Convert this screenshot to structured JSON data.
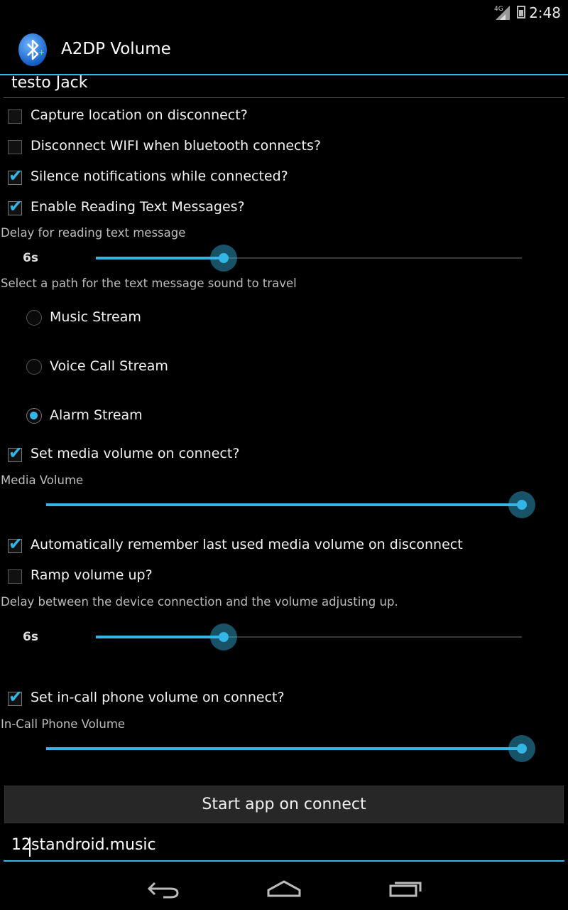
{
  "status_bar": {
    "time": "2:48",
    "network": "4G"
  },
  "app": {
    "title": "A2DP Volume",
    "icon": "bluetooth-icon"
  },
  "device_name": "testo Jack",
  "options": {
    "capture_location": {
      "label": "Capture location on disconnect?",
      "checked": false
    },
    "disconnect_wifi": {
      "label": "Disconnect WIFI when bluetooth connects?",
      "checked": false
    },
    "silence_notifications": {
      "label": "Silence notifications while connected?",
      "checked": true
    },
    "enable_reading_text": {
      "label": "Enable Reading Text Messages?",
      "checked": true
    }
  },
  "text_delay": {
    "caption": "Delay for reading text message",
    "value_label": "6s",
    "fraction": 0.3
  },
  "sound_path": {
    "caption": "Select a path for the text message sound to travel",
    "options": [
      {
        "label": "Music Stream",
        "selected": false
      },
      {
        "label": "Voice Call Stream",
        "selected": false
      },
      {
        "label": "Alarm Stream",
        "selected": true
      }
    ]
  },
  "media_volume": {
    "checkbox_label": "Set media volume on connect?",
    "checked": true,
    "caption": "Media Volume",
    "fraction": 1.0
  },
  "remember_volume": {
    "label": "Automatically remember last used media volume on disconnect",
    "checked": true
  },
  "ramp_volume": {
    "label": "Ramp volume up?",
    "checked": false
  },
  "ramp_delay": {
    "caption": "Delay between the device connection and the volume adjusting up.",
    "value_label": "6s",
    "fraction": 0.3
  },
  "incall_volume": {
    "checkbox_label": "Set in-call phone volume on connect?",
    "checked": true,
    "caption": "In-Call Phone Volume",
    "fraction": 1.0
  },
  "start_app": {
    "button_label": "Start app on connect",
    "package_value": "12standroid.music"
  },
  "colors": {
    "accent": "#33b5e5",
    "background": "#000000"
  },
  "nav": {
    "back_icon": "back-icon",
    "home_icon": "home-icon",
    "recents_icon": "recents-icon"
  }
}
